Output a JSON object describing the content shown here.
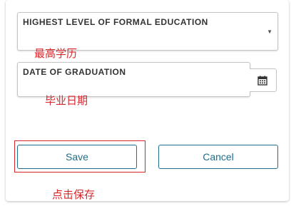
{
  "form": {
    "education": {
      "label": "HIGHEST LEVEL OF FORMAL EDUCATION",
      "arrow": "▼"
    },
    "education_note": "最高学历",
    "graduation": {
      "label": "DATE OF GRADUATION"
    },
    "graduation_note": "毕业日期"
  },
  "actions": {
    "save_label": "Save",
    "cancel_label": "Cancel",
    "save_note": "点击保存"
  },
  "colors": {
    "accent": "#1f6e8c",
    "annotation": "#d9262b"
  },
  "icons": {
    "calendar": "calendar-icon",
    "dropdown": "chevron-down-icon"
  }
}
